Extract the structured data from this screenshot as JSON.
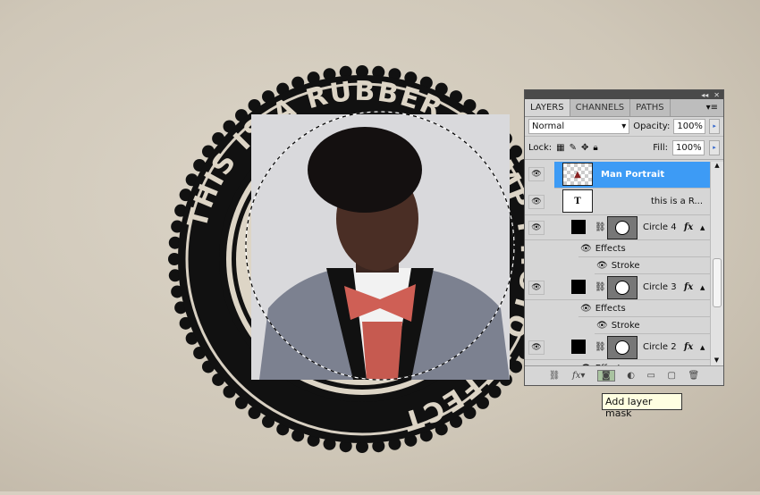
{
  "stamp": {
    "ring_text": "THIS IS A RUBBER STAMP PHOTO EFFECT"
  },
  "panel": {
    "tabs": [
      {
        "label": "LAYERS"
      },
      {
        "label": "CHANNELS"
      },
      {
        "label": "PATHS"
      }
    ],
    "blend_mode": "Normal",
    "opacity_label": "Opacity:",
    "opacity": "100%",
    "lock_label": "Lock:",
    "fill_label": "Fill:",
    "fill": "100%",
    "layers": [
      {
        "name": "Man Portrait"
      },
      {
        "name": "this is a R..."
      },
      {
        "name": "Circle 4",
        "effects": "Effects",
        "stroke": "Stroke"
      },
      {
        "name": "Circle 3",
        "effects": "Effects",
        "stroke": "Stroke"
      },
      {
        "name": "Circle 2",
        "effects": "Effects"
      }
    ],
    "fx": "fx"
  },
  "tooltip": "Add layer mask",
  "colors": {
    "selected": "#3d9bf5",
    "stamp": "#111111"
  }
}
